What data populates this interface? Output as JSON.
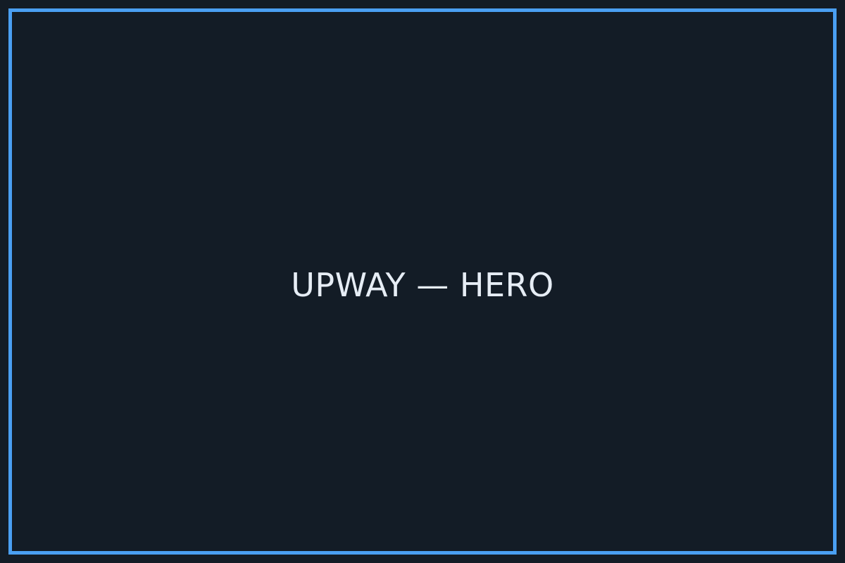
{
  "hero": {
    "title": "UPWAY — HERO"
  },
  "colors": {
    "background": "#131c26",
    "border": "#4a9ff2",
    "text": "#e6edf5"
  }
}
